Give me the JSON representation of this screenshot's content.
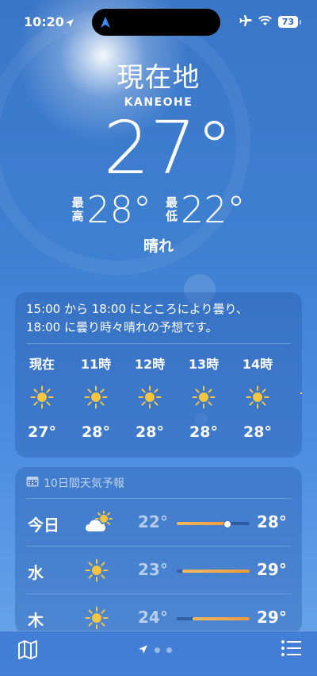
{
  "status_bar": {
    "time": "10:20",
    "battery": "73"
  },
  "hero": {
    "city": "現在地",
    "subtitle": "KANEOHE",
    "temperature": "27°",
    "high_label_top": "最",
    "high_label_bottom": "高",
    "high": "28°",
    "low_label_top": "最",
    "low_label_bottom": "低",
    "low": "22°",
    "condition": "晴れ"
  },
  "hourly": {
    "summary_line1": "15:00 から 18:00 にところにより曇り、",
    "summary_line2": "18:00 に曇り時々晴れの予想です。",
    "hours": [
      {
        "label": "現在",
        "icon": "sun-icon",
        "temp": "27°"
      },
      {
        "label": "11時",
        "icon": "sun-icon",
        "temp": "28°"
      },
      {
        "label": "12時",
        "icon": "sun-icon",
        "temp": "28°"
      },
      {
        "label": "13時",
        "icon": "sun-icon",
        "temp": "28°"
      },
      {
        "label": "14時",
        "icon": "sun-icon",
        "temp": "28°"
      },
      {
        "label": "1",
        "icon": "sun-icon",
        "temp": "2"
      }
    ]
  },
  "daily": {
    "title": "10日間天気予報",
    "days": [
      {
        "day": "今日",
        "icon": "partly-cloudy-icon",
        "low": "22°",
        "high": "28°",
        "bar_start": 0.0,
        "bar_end": 0.72,
        "current": 0.68
      },
      {
        "day": "水",
        "icon": "sun-icon",
        "low": "23°",
        "high": "29°",
        "bar_start": 0.08,
        "bar_end": 1.0
      },
      {
        "day": "木",
        "icon": "sun-icon",
        "low": "24°",
        "high": "29°",
        "bar_start": 0.22,
        "bar_end": 1.0
      }
    ]
  },
  "bottom_bar": {
    "page_count": 3,
    "active_page": 0
  },
  "colors": {
    "sun": "#f5c542",
    "bar_fill": "#f09a3a"
  }
}
